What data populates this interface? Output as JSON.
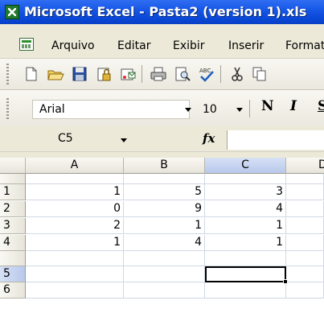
{
  "window": {
    "title": "Microsoft Excel - Pasta2 (version 1).xls"
  },
  "menu": {
    "items": [
      "Arquivo",
      "Editar",
      "Exibir",
      "Inserir",
      "Formatar"
    ]
  },
  "toolbar": {
    "icons": [
      "new-icon",
      "open-icon",
      "save-icon",
      "permission-icon",
      "email-icon",
      "print-icon",
      "print-preview-icon",
      "spelling-icon",
      "cut-icon",
      "copy-icon"
    ]
  },
  "format": {
    "font": "Arial",
    "size": "10",
    "bold": "N",
    "italic": "I",
    "underline": "S"
  },
  "formula": {
    "namebox": "C5",
    "fx": "fx",
    "value": ""
  },
  "grid": {
    "columns": [
      "A",
      "B",
      "C",
      "D"
    ],
    "rows": [
      "1",
      "2",
      "3",
      "4",
      "5",
      "6"
    ],
    "cells": [
      [
        "1",
        "5",
        "3",
        ""
      ],
      [
        "0",
        "9",
        "4",
        ""
      ],
      [
        "2",
        "1",
        "1",
        ""
      ],
      [
        "1",
        "4",
        "1",
        ""
      ],
      [
        "",
        "",
        "",
        ""
      ],
      [
        "",
        "",
        "",
        ""
      ]
    ],
    "active": "C5"
  },
  "colors": {
    "titlebar": "#0a48d8",
    "selected_header": "#b9c9ec",
    "gridline": "#d0d7e5"
  }
}
